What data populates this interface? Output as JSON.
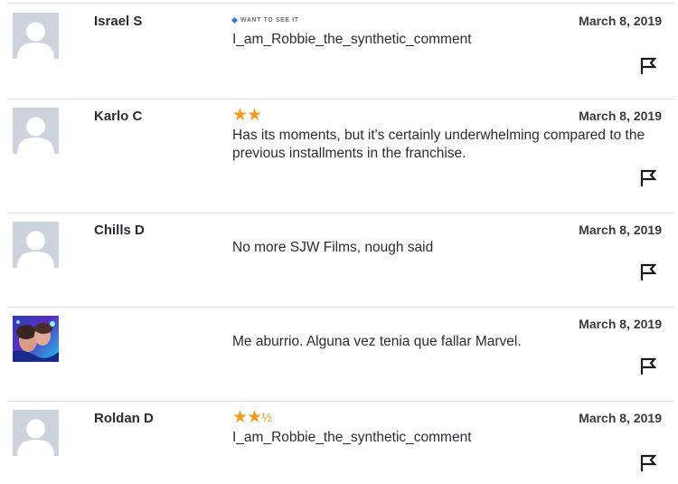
{
  "reviews": [
    {
      "avatar": "default-avatar",
      "name": "Israel S",
      "rating": "",
      "want_to_see": "WANT TO SEE IT",
      "comment": "I_am_Robbie_the_synthetic_comment",
      "date": "March 8, 2019",
      "flag_icon": "flag-icon"
    },
    {
      "avatar": "default-avatar",
      "name": "Karlo C",
      "rating": "★★",
      "comment": "Has its moments, but it's certainly underwhelming compared to the previous installments in the franchise.",
      "date": "March 8, 2019",
      "flag_icon": "flag-icon"
    },
    {
      "avatar": "default-avatar",
      "name": "Chills D",
      "rating": "",
      "comment": "No more SJW Films, nough said",
      "date": "March 8, 2019",
      "flag_icon": "flag-icon"
    },
    {
      "avatar": "photo-avatar",
      "name": "",
      "rating": "",
      "comment": "Me aburrio. Alguna vez tenia que fallar Marvel.",
      "date": "March 8, 2019",
      "flag_icon": "flag-icon"
    },
    {
      "avatar": "default-avatar",
      "name": "Roldan D",
      "rating": "★★",
      "rating_half": "½",
      "comment": "I_am_Robbie_the_synthetic_comment",
      "date": "March 8, 2019",
      "flag_icon": "flag-icon"
    }
  ],
  "colors": {
    "star": "#f39c21",
    "want_diamond": "#3976dc",
    "divider": "#dcdcdc",
    "avatar_bg": "#cdd3dc"
  }
}
